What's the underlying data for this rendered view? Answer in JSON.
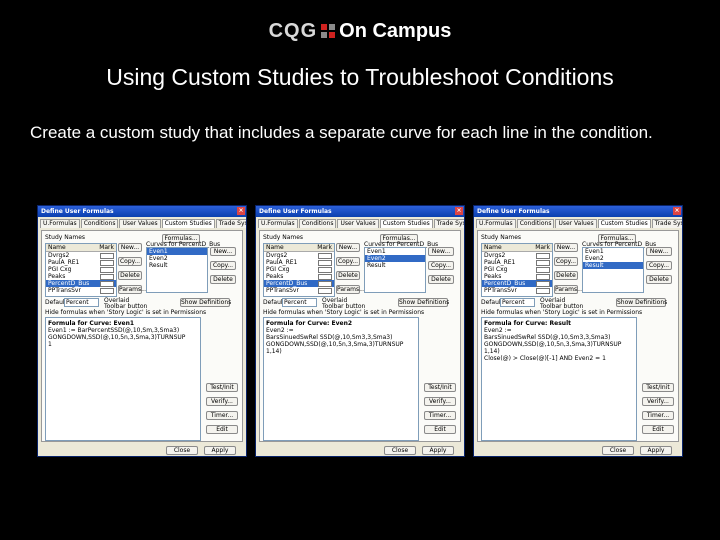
{
  "logo": {
    "cqg": "CQG",
    "on_campus": "On Campus"
  },
  "slide": {
    "title": "Using Custom Studies to Troubleshoot Conditions",
    "body": "Create a custom study that includes a separate curve for each line in the condition."
  },
  "dialogs": [
    {
      "title": "Define User Formulas",
      "tabs": [
        "U.Formulas",
        "Conditions",
        "User Values",
        "Custom Studies",
        "Trade Systems"
      ],
      "study_names_label": "Study Names",
      "col_name": "Name",
      "col_hot": "Mark",
      "studies": [
        "Dvrgs2",
        "PaulA_RE1",
        "PGI Cxg",
        "Peaks",
        "PercentD_Bus",
        "PPTransSvr"
      ],
      "selected_study": 4,
      "buttons_left": [
        "New...",
        "Copy...",
        "Delete"
      ],
      "params_label": "Params...",
      "curves_label": "Curves for PercentD_Bus",
      "curves": [
        "Even1",
        "Even2",
        "Result"
      ],
      "curve_buttons": [
        "New...",
        "Copy...",
        "Delete"
      ],
      "formulas_btn": "Formulas...",
      "show_def_btn": "Show Definitions",
      "default_label": "Default:",
      "default_value": "Percent",
      "overlaid_label": "Overlaid",
      "toolbar_label": "Toolbar button",
      "hide_label": "Hide formulas when 'Story Logic' is set in Permissions",
      "formula_header": "Formula for Curve: Even1",
      "formula_lines": [
        "Even1 := BarPercentSSD(@,10,Sm,3,Sma3)",
        "GONGDOWN,SSD(@,10,5n,3,Sma,3)TURNSUP",
        "1"
      ],
      "side_buttons": [
        "Test/Init",
        "Verify...",
        "Timer...",
        "Edit"
      ],
      "close_label": "Close",
      "apply_label": "Apply"
    },
    {
      "title": "Define User Formulas",
      "tabs": [
        "U.Formulas",
        "Conditions",
        "User Values",
        "Custom Studies",
        "Trade Systems"
      ],
      "study_names_label": "Study Names",
      "col_name": "Name",
      "col_hot": "Mark",
      "studies": [
        "Dvrgs2",
        "PaulA_RE1",
        "PGI Cxg",
        "Peaks",
        "PercentD_Bus",
        "PPTransSvr"
      ],
      "selected_study": 4,
      "buttons_left": [
        "New...",
        "Copy...",
        "Delete"
      ],
      "params_label": "Params...",
      "curves_label": "Curves for PercentD_Bus",
      "curves": [
        "Even1",
        "Even2",
        "Result"
      ],
      "curve_buttons": [
        "New...",
        "Copy...",
        "Delete"
      ],
      "formulas_btn": "Formulas...",
      "show_def_btn": "Show Definitions",
      "default_label": "Default:",
      "default_value": "Percent",
      "overlaid_label": "Overlaid",
      "toolbar_label": "Toolbar button",
      "hide_label": "Hide formulas when 'Story Logic' is set in Permissions",
      "formula_header": "Formula for Curve: Even2",
      "formula_lines": [
        "Even2 :=",
        "BarsSinuedSwRel SSD(@,10,Sm3,3,Sma3)",
        "GONGDOWN,SSD(@,10,5n,3,Sma,3)TURNSUP",
        "1,14)"
      ],
      "side_buttons": [
        "Test/Init",
        "Verify...",
        "Timer...",
        "Edit"
      ],
      "close_label": "Close",
      "apply_label": "Apply"
    },
    {
      "title": "Define User Formulas",
      "tabs": [
        "U.Formulas",
        "Conditions",
        "User Values",
        "Custom Studies",
        "Trade Systems"
      ],
      "study_names_label": "Study Names",
      "col_name": "Name",
      "col_hot": "Mark",
      "studies": [
        "Dvrgs2",
        "PaulA_RE1",
        "PGI Cxg",
        "Peaks",
        "PercentD_Bus",
        "PPTransSvr"
      ],
      "selected_study": 4,
      "buttons_left": [
        "New...",
        "Copy...",
        "Delete"
      ],
      "params_label": "Params...",
      "curves_label": "Curves for PercentD_Bus",
      "curves": [
        "Even1",
        "Even2",
        "Result"
      ],
      "curve_buttons": [
        "New...",
        "Copy...",
        "Delete"
      ],
      "formulas_btn": "Formulas...",
      "show_def_btn": "Show Definitions",
      "default_label": "Default:",
      "default_value": "Percent",
      "overlaid_label": "Overlaid",
      "toolbar_label": "Toolbar button",
      "hide_label": "Hide formulas when 'Story Logic' is set in Permissions",
      "formula_header": "Formula for Curve: Result",
      "formula_lines": [
        "Even2 :=",
        "BarsSinuedSwRel SSD(@,10,Sm3,3,Sma3)",
        "GONGDOWN,SSD(@,10,5n,3,Sma,3)TURNSUP",
        "1,14)",
        "",
        "Close(@) > Close(@)[-1] AND Even2 = 1"
      ],
      "side_buttons": [
        "Test/Init",
        "Verify...",
        "Timer...",
        "Edit"
      ],
      "close_label": "Close",
      "apply_label": "Apply"
    }
  ]
}
